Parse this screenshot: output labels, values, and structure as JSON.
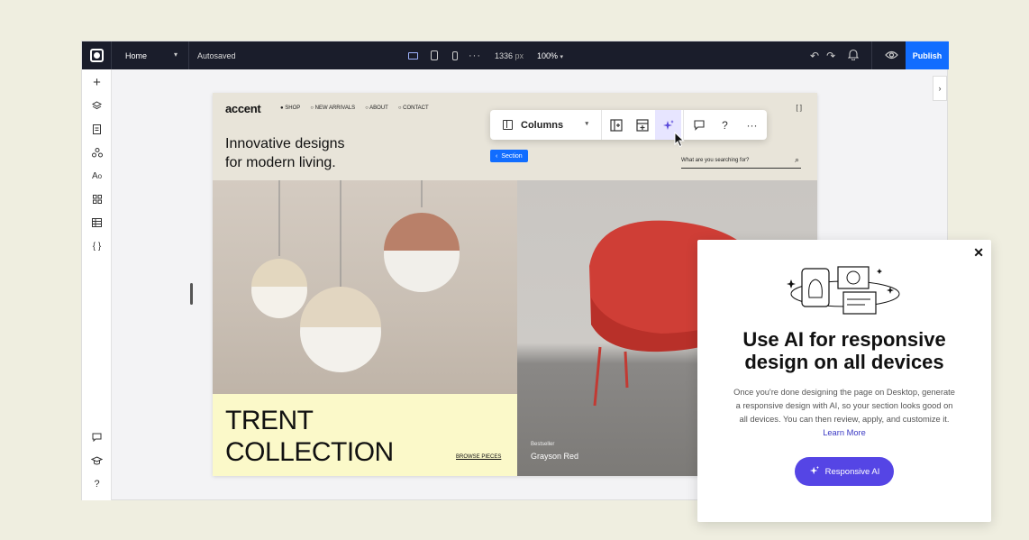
{
  "topbar": {
    "page_name": "Home",
    "autosaved": "Autosaved",
    "width_px": "1336",
    "width_unit": "px",
    "zoom": "100%",
    "publish": "Publish"
  },
  "site": {
    "brand": "accent",
    "nav": [
      "SHOP",
      "NEW ARRIVALS",
      "ABOUT",
      "CONTACT"
    ],
    "bracket": "[ ]",
    "hero_line1": "Innovative designs",
    "hero_line2": "for modern living.",
    "section_tag": "Section",
    "search_placeholder": "What are you searching for?",
    "collection_line1": "TRENT",
    "collection_line2": "COLLECTION",
    "browse": "BROWSE PIECES",
    "bestseller": "Bestseller",
    "product_name": "Grayson Red"
  },
  "floating_toolbar": {
    "columns_label": "Columns",
    "help": "?",
    "more": "···"
  },
  "popup": {
    "title_line1": "Use AI for responsive",
    "title_line2": "design on all devices",
    "body": "Once you're done designing the page on Desktop, generate a responsive design with AI, so your section looks good on all devices. You can then review, apply, and customize it. ",
    "learn_more": "Learn More",
    "button": "Responsive AI"
  },
  "colors": {
    "publish": "#116dff",
    "ai_button": "#5545e5",
    "topbar": "#1a1d2b",
    "background": "#efeee0"
  }
}
